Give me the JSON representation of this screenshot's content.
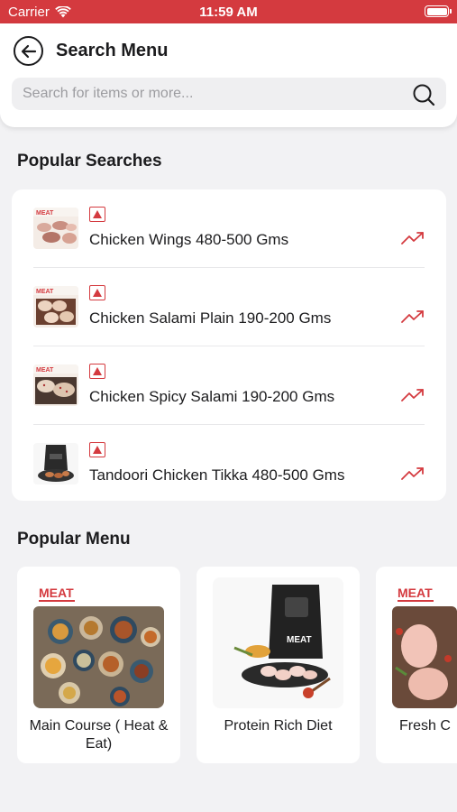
{
  "status_bar": {
    "carrier": "Carrier",
    "time": "11:59 AM"
  },
  "header": {
    "title": "Search Menu"
  },
  "search": {
    "placeholder": "Search for items or more..."
  },
  "popular_searches": {
    "title": "Popular Searches",
    "items": [
      {
        "label": "Chicken Wings 480-500 Gms",
        "icon": "trending-up-icon"
      },
      {
        "label": "Chicken Salami Plain 190-200 Gms",
        "icon": "trending-up-icon"
      },
      {
        "label": "Chicken Spicy Salami 190-200 Gms",
        "icon": "trending-up-icon"
      },
      {
        "label": "Tandoori Chicken Tikka 480-500 Gms",
        "icon": "trending-up-icon"
      }
    ]
  },
  "popular_menu": {
    "title": "Popular Menu",
    "items": [
      {
        "label": "Main Course ( Heat & Eat)",
        "brand": "MEAT"
      },
      {
        "label": "Protein Rich Diet",
        "brand": "MEAT"
      },
      {
        "label": "Fresh C",
        "brand": "MEAT"
      }
    ]
  },
  "colors": {
    "accent": "#d43a3f",
    "background": "#f2f2f4",
    "card": "#ffffff"
  }
}
